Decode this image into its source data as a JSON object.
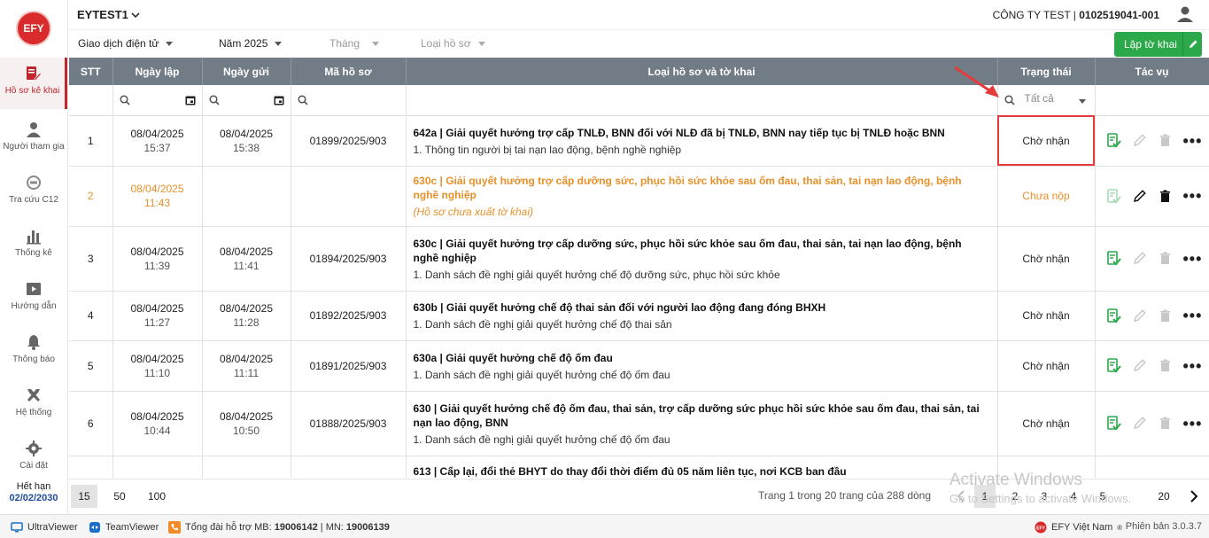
{
  "app": {
    "logo_text": "EFY",
    "account": "EYTEST1",
    "company_name": "CÔNG TY TEST | ",
    "company_code": "0102519041-001"
  },
  "sidebar": {
    "items": [
      {
        "label": "Hồ sơ kê khai",
        "icon": "document-edit-icon",
        "active": true
      },
      {
        "label": "Người tham gia",
        "icon": "person-icon"
      },
      {
        "label": "Tra cứu C12",
        "icon": "lookup-icon"
      },
      {
        "label": "Thống kê",
        "icon": "bar-chart-icon"
      },
      {
        "label": "Hướng dẫn",
        "icon": "guide-icon"
      },
      {
        "label": "Thông báo",
        "icon": "bell-icon"
      },
      {
        "label": "Hệ thống",
        "icon": "tools-icon"
      },
      {
        "label": "Cài đặt",
        "icon": "gear-icon"
      }
    ],
    "expiry_label": "Hết hạn",
    "expiry_date": "02/02/2030"
  },
  "filters": {
    "type": "Giao dịch điện tử",
    "year": "Năm 2025",
    "month": "Tháng",
    "doc_type": "Loại hồ sơ",
    "create_button": "Lập tờ khai"
  },
  "table": {
    "headers": [
      "STT",
      "Ngày lập",
      "Ngày gửi",
      "Mã hồ sơ",
      "Loại hồ sơ và tờ khai",
      "Trạng thái",
      "Tác vụ"
    ],
    "status_filter": "Tất cả",
    "rows": [
      {
        "stt": "1",
        "created_date": "08/04/2025",
        "created_time": "15:37",
        "sent_date": "08/04/2025",
        "sent_time": "15:38",
        "code": "01899/2025/903",
        "title": "642a | Giải quyết hưởng trợ cấp TNLĐ, BNN đối với NLĐ đã bị TNLĐ, BNN nay tiếp tục bị TNLĐ hoặc BNN",
        "detail": "1. Thông tin người bị tai nạn lao động, bệnh nghề nghiệp",
        "status": "Chờ nhận"
      },
      {
        "stt": "2",
        "created_date": "08/04/2025",
        "created_time": "11:43",
        "sent_date": "",
        "sent_time": "",
        "code": "",
        "title": "630c | Giải quyết hưởng trợ cấp dưỡng sức, phục hồi sức khỏe sau ốm đau, thai sản, tai nạn lao động, bệnh nghề nghiệp",
        "detail": "(Hồ sơ chưa xuất tờ khai)",
        "status": "Chưa nộp"
      },
      {
        "stt": "3",
        "created_date": "08/04/2025",
        "created_time": "11:39",
        "sent_date": "08/04/2025",
        "sent_time": "11:41",
        "code": "01894/2025/903",
        "title": "630c | Giải quyết hưởng trợ cấp dưỡng sức, phục hồi sức khỏe sau ốm đau, thai sản, tai nạn lao động, bệnh nghề nghiệp",
        "detail": "1. Danh sách đề nghị giải quyết hưởng chế độ dưỡng sức, phục hồi sức khỏe",
        "status": "Chờ nhận"
      },
      {
        "stt": "4",
        "created_date": "08/04/2025",
        "created_time": "11:27",
        "sent_date": "08/04/2025",
        "sent_time": "11:28",
        "code": "01892/2025/903",
        "title": "630b | Giải quyết hưởng chế độ thai sản đối với người lao động đang đóng BHXH",
        "detail": "1. Danh sách đề nghị giải quyết hưởng chế độ thai sản",
        "status": "Chờ nhận"
      },
      {
        "stt": "5",
        "created_date": "08/04/2025",
        "created_time": "11:10",
        "sent_date": "08/04/2025",
        "sent_time": "11:11",
        "code": "01891/2025/903",
        "title": "630a | Giải quyết hưởng chế độ ốm đau",
        "detail": "1. Danh sách đề nghị giải quyết hưởng chế độ ốm đau",
        "status": "Chờ nhận"
      },
      {
        "stt": "6",
        "created_date": "08/04/2025",
        "created_time": "10:44",
        "sent_date": "08/04/2025",
        "sent_time": "10:50",
        "code": "01888/2025/903",
        "title": "630 | Giải quyết hưởng chế độ ốm đau, thai sản, trợ cấp dưỡng sức phục hồi sức khỏe sau ốm đau, thai sản, tai nạn lao động, BNN",
        "detail": "1. Danh sách đề nghị giải quyết hưởng chế độ ốm đau",
        "status": "Chờ nhận"
      },
      {
        "stt": "",
        "created_date": "",
        "created_time": "",
        "sent_date": "",
        "sent_time": "",
        "code": "",
        "title": "613 | Cấp lại, đổi thẻ BHYT do thay đổi thời điểm đủ 05 năm liên tục, nơi KCB ban đầu",
        "detail": "",
        "status": ""
      }
    ]
  },
  "pager": {
    "sizes": [
      "15",
      "50",
      "100"
    ],
    "info": "Trang 1 trong 20 trang của 288 dòng",
    "pages": [
      "1",
      "2",
      "3",
      "4",
      "5",
      "20"
    ]
  },
  "watermark": {
    "line1": "Activate Windows",
    "line2": "Go to Settings to activate Windows."
  },
  "statusbar": {
    "ultraviewer": "UltraViewer",
    "teamviewer": "TeamViewer",
    "hotline_prefix": "Tổng đài hỗ trợ MB: ",
    "hotline_mb": "19006142",
    "hotline_mid": " | MN: ",
    "hotline_mn": "19006139",
    "brand": "EFY Việt Nam",
    "version": "Phiên bản 3.0.3.7"
  },
  "colors": {
    "brand_red": "#c0262d",
    "accent_green": "#2aa84a",
    "pending_orange": "#e8912a",
    "header_gray": "#717c86"
  }
}
